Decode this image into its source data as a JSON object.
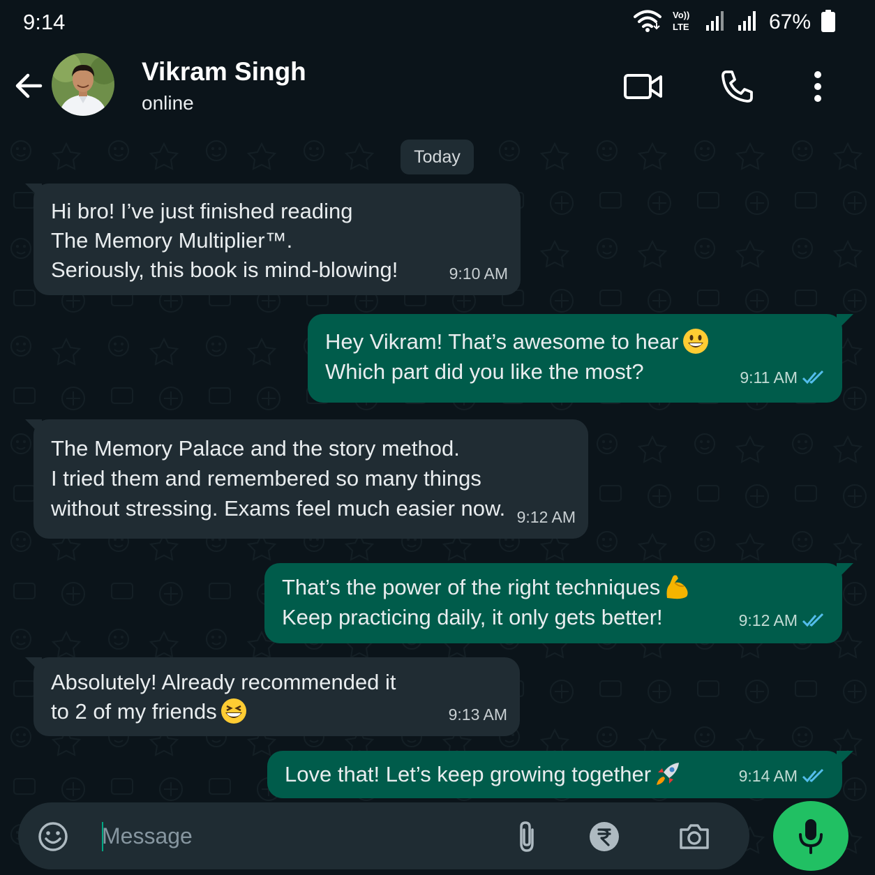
{
  "status_bar": {
    "time": "9:14",
    "network_label": "Vo)) LTE",
    "battery_percent": "67%",
    "icons": [
      "wifi-icon",
      "volte-icon",
      "signal-icon",
      "signal-icon",
      "battery-icon"
    ]
  },
  "header": {
    "contact_name": "Vikram Singh",
    "contact_status": "online",
    "icons": [
      "back-arrow-icon",
      "video-call-icon",
      "phone-icon",
      "more-vertical-icon"
    ]
  },
  "chat": {
    "date_chip": "Today",
    "messages": [
      {
        "direction": "incoming",
        "lines": [
          "Hi bro! I’ve just finished reading",
          "The Memory Multiplier™.",
          "Seriously, this book is mind-blowing!"
        ],
        "time": "9:10 AM"
      },
      {
        "direction": "outgoing",
        "lines": [
          "Hey Vikram! That’s awesome to hear",
          "Which part did you like the most?"
        ],
        "emoji": "grinning-face-emoji",
        "time": "9:11 AM",
        "read": true
      },
      {
        "direction": "incoming",
        "lines": [
          "The Memory Palace and the story method.",
          "I tried them and remembered so many things",
          "without stressing. Exams feel much easier now."
        ],
        "time": "9:12 AM"
      },
      {
        "direction": "outgoing",
        "lines": [
          "That’s the power of the right techniques",
          "Keep practicing daily, it only gets better!"
        ],
        "emoji": "flexed-biceps-emoji",
        "time": "9:12 AM",
        "read": true
      },
      {
        "direction": "incoming",
        "lines": [
          "Absolutely! Already recommended it",
          "to 2 of my friends"
        ],
        "emoji": "grinning-squinting-face-emoji",
        "time": "9:13 AM"
      },
      {
        "direction": "outgoing",
        "lines": [
          "Love that! Let’s keep growing together"
        ],
        "emoji": "rocket-emoji",
        "time": "9:14 AM",
        "read": true
      }
    ]
  },
  "composer": {
    "placeholder": "Message",
    "icons": [
      "emoji-icon",
      "attach-icon",
      "rupee-payment-icon",
      "camera-icon",
      "mic-icon"
    ]
  },
  "colors": {
    "background": "#0b141a",
    "incoming_bubble": "#202c33",
    "outgoing_bubble": "#005c4b",
    "read_ticks": "#53bdeb",
    "mic_button": "#21c063"
  }
}
